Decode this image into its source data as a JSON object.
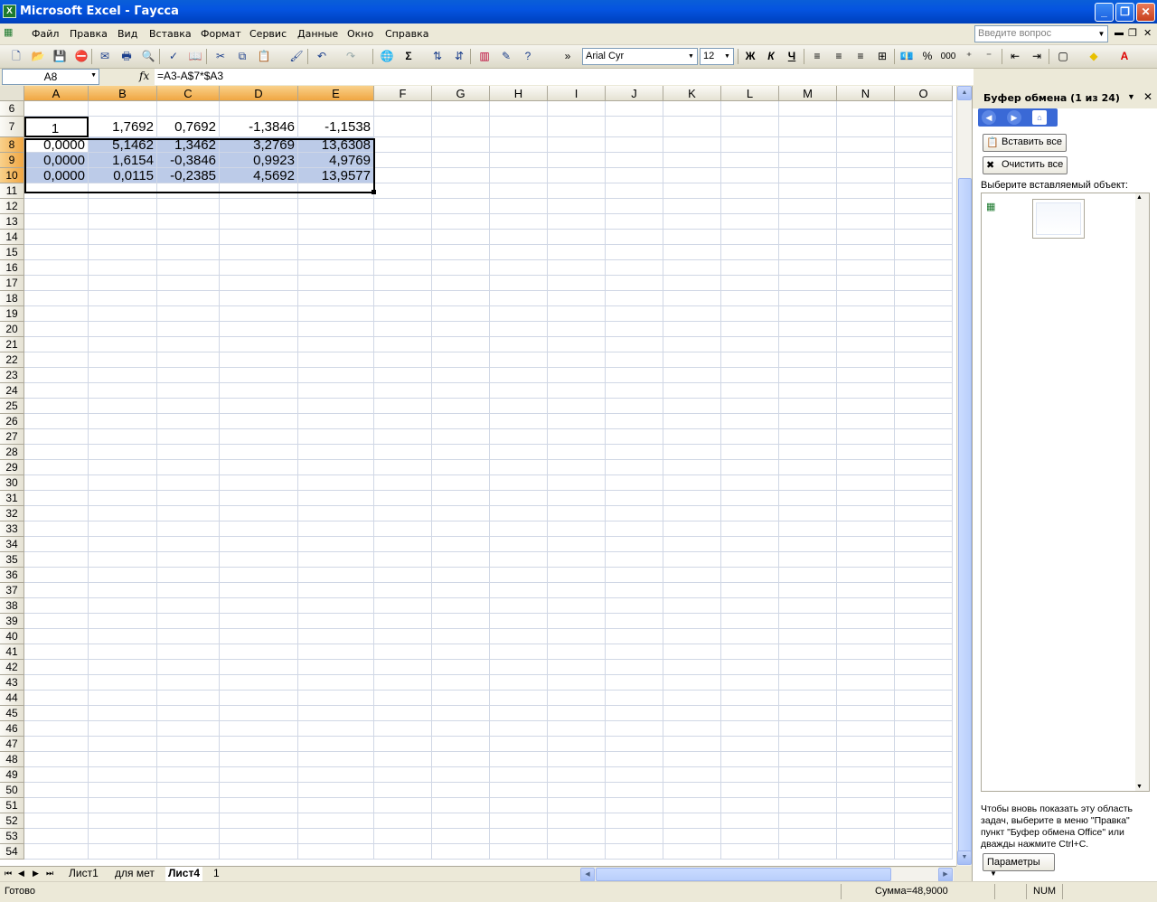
{
  "window": {
    "title": "Microsoft Excel - Гаусса",
    "app_icon": "excel-icon",
    "controls": [
      "_",
      "❐",
      "✕"
    ]
  },
  "menu": {
    "items": [
      "Файл",
      "Правка",
      "Вид",
      "Вставка",
      "Формат",
      "Сервис",
      "Данные",
      "Окно",
      "Справка"
    ],
    "ask_placeholder": "Введите вопрос"
  },
  "toolbar": {
    "font_name": "Arial Cyr",
    "font_size": "12",
    "bold": "Ж",
    "italic": "К",
    "underline": "Ч",
    "sum_symbol": "Σ",
    "percent": "%",
    "thousands": "000"
  },
  "formula_bar": {
    "name_box": "A8",
    "fx": "fx",
    "formula": "=A3-A$7*$A3"
  },
  "grid": {
    "columns": [
      "A",
      "B",
      "C",
      "D",
      "E",
      "F",
      "G",
      "H",
      "I",
      "J",
      "K",
      "L",
      "M",
      "N",
      "O"
    ],
    "selected_columns": [
      "A",
      "B",
      "C",
      "D",
      "E"
    ],
    "first_row": 6,
    "last_row": 54,
    "selected_rows": [
      8,
      9,
      10
    ],
    "cells": {
      "r7": [
        "1",
        "1,7692",
        "0,7692",
        "-1,3846",
        "-1,1538"
      ],
      "r8": [
        "0,0000",
        "5,1462",
        "1,3462",
        "3,2769",
        "13,6308"
      ],
      "r9": [
        "0,0000",
        "1,6154",
        "-0,3846",
        "0,9923",
        "4,9769"
      ],
      "r10": [
        "0,0000",
        "0,0115",
        "-0,2385",
        "4,5692",
        "13,9577"
      ]
    }
  },
  "sheets": {
    "tabs": [
      "Лист1",
      "для мет",
      "Лист4",
      "1"
    ],
    "active": "Лист4",
    "nav": [
      "⏮",
      "◀",
      "▶",
      "⏭"
    ]
  },
  "status": {
    "ready": "Готово",
    "sum": "Сумма=48,9000",
    "num": "NUM"
  },
  "task_pane": {
    "title": "Буфер обмена (1 из 24)",
    "paste_all": "Вставить все",
    "clear_all": "Очистить все",
    "select_label": "Выберите вставляемый объект:",
    "note": "Чтобы вновь показать эту область задач, выберите в меню \"Правка\" пункт \"Буфер обмена Office\" или дважды нажмите Ctrl+C.",
    "params": "Параметры"
  }
}
